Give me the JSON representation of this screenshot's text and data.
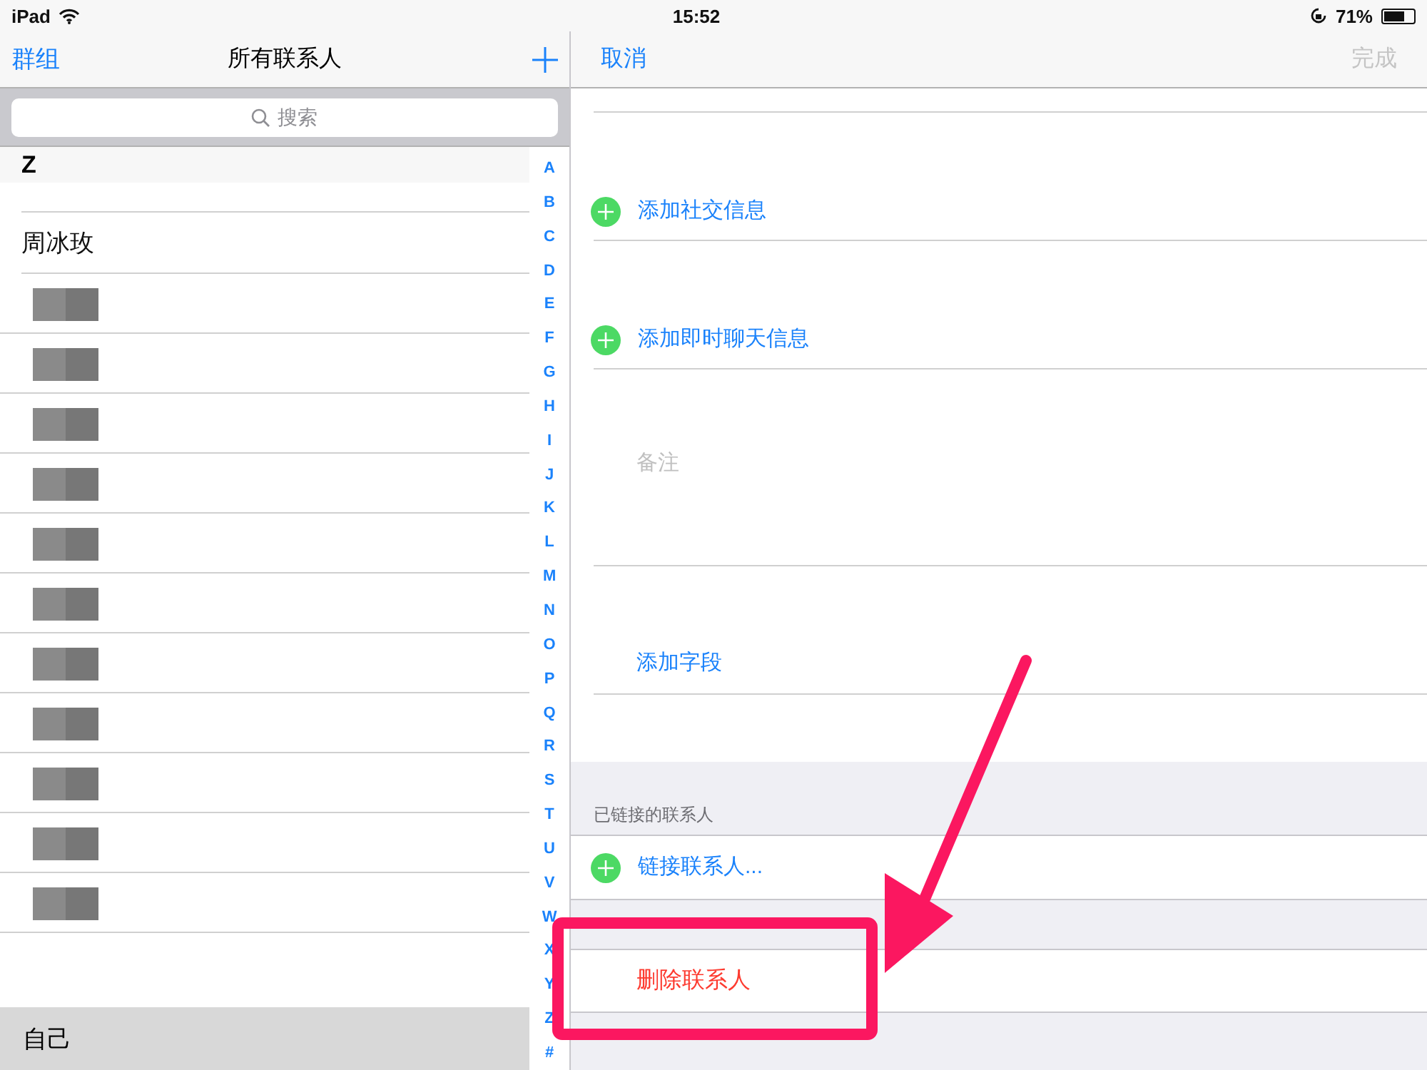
{
  "status_bar": {
    "device": "iPad",
    "time": "15:52",
    "battery": "71%"
  },
  "contacts_pane": {
    "nav": {
      "back": "群组",
      "title": "所有联系人"
    },
    "search": {
      "placeholder": "搜索"
    },
    "section_header": "Z",
    "rows": [
      {
        "kind": "name",
        "name": "周冰玫"
      },
      {
        "kind": "redacted"
      },
      {
        "kind": "redacted"
      },
      {
        "kind": "redacted"
      },
      {
        "kind": "redacted"
      },
      {
        "kind": "redacted"
      },
      {
        "kind": "redacted"
      },
      {
        "kind": "redacted"
      },
      {
        "kind": "redacted"
      },
      {
        "kind": "redacted"
      },
      {
        "kind": "redacted"
      },
      {
        "kind": "redacted"
      }
    ],
    "index": [
      "A",
      "B",
      "C",
      "D",
      "E",
      "F",
      "G",
      "H",
      "I",
      "J",
      "K",
      "L",
      "M",
      "N",
      "O",
      "P",
      "Q",
      "R",
      "S",
      "T",
      "U",
      "V",
      "W",
      "X",
      "Y",
      "Z",
      "#"
    ],
    "footer": "自己"
  },
  "detail_pane": {
    "nav": {
      "cancel": "取消",
      "done": {
        "label": "完成",
        "disabled": true
      }
    },
    "rows": [
      {
        "kind": "add",
        "label": "添加社交信息"
      },
      {
        "kind": "add",
        "label": "添加即时聊天信息"
      },
      {
        "kind": "note",
        "label": "备注"
      },
      {
        "kind": "field",
        "label": "添加字段"
      },
      {
        "kind": "gap"
      },
      {
        "kind": "header",
        "label": "已链接的联系人"
      },
      {
        "kind": "link",
        "label": "链接联系人..."
      },
      {
        "kind": "spacer"
      },
      {
        "kind": "delete",
        "label": "删除联系人"
      }
    ]
  },
  "annotation": {
    "arrow": true,
    "highlight": true
  }
}
